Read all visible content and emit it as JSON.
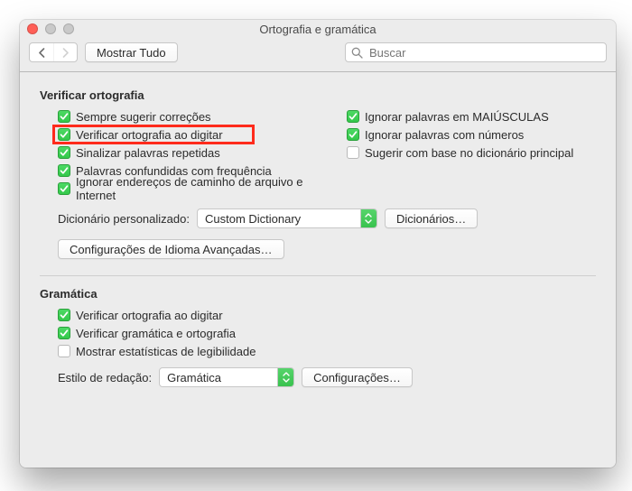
{
  "window": {
    "title": "Ortografia e gramática"
  },
  "toolbar": {
    "back_enabled": true,
    "forward_enabled": false,
    "show_all_label": "Mostrar Tudo",
    "search_placeholder": "Buscar"
  },
  "spelling": {
    "heading": "Verificar ortografia",
    "left": [
      {
        "id": "always-suggest",
        "label": "Sempre sugerir correções",
        "checked": true
      },
      {
        "id": "check-as-type",
        "label": "Verificar ortografia ao digitar",
        "checked": true,
        "highlight": true
      },
      {
        "id": "flag-repeated",
        "label": "Sinalizar palavras repetidas",
        "checked": true
      },
      {
        "id": "confused-words",
        "label": "Palavras confundidas com frequência",
        "checked": true
      },
      {
        "id": "ignore-paths",
        "label": "Ignorar endereços de caminho de arquivo e Internet",
        "checked": true
      }
    ],
    "right": [
      {
        "id": "ignore-uppercase",
        "label": "Ignorar palavras em MAIÚSCULAS",
        "checked": true
      },
      {
        "id": "ignore-numbers",
        "label": "Ignorar palavras com números",
        "checked": true
      },
      {
        "id": "suggest-main-dict",
        "label": "Sugerir com base no dicionário principal",
        "checked": false
      }
    ],
    "custom_dict_label": "Dicionário personalizado:",
    "custom_dict_value": "Custom Dictionary",
    "dictionaries_button": "Dicionários…",
    "advanced_button": "Configurações de Idioma Avançadas…"
  },
  "grammar": {
    "heading": "Gramática",
    "items": [
      {
        "id": "g-check-as-type",
        "label": "Verificar ortografia ao digitar",
        "checked": true
      },
      {
        "id": "g-check-grammar",
        "label": "Verificar gramática e ortografia",
        "checked": true
      },
      {
        "id": "g-readability",
        "label": "Mostrar estatísticas de legibilidade",
        "checked": false
      }
    ],
    "style_label": "Estilo de redação:",
    "style_value": "Gramática",
    "settings_button": "Configurações…"
  },
  "icons": {
    "search": "search-icon",
    "chevron_left": "chevron-left-icon",
    "chevron_right": "chevron-right-icon",
    "updown": "updown-stepper-icon",
    "check": "checkmark-icon"
  },
  "colors": {
    "accent_green": "#3fc553",
    "highlight_red": "#ff2b1c",
    "window_bg": "#ececec"
  }
}
